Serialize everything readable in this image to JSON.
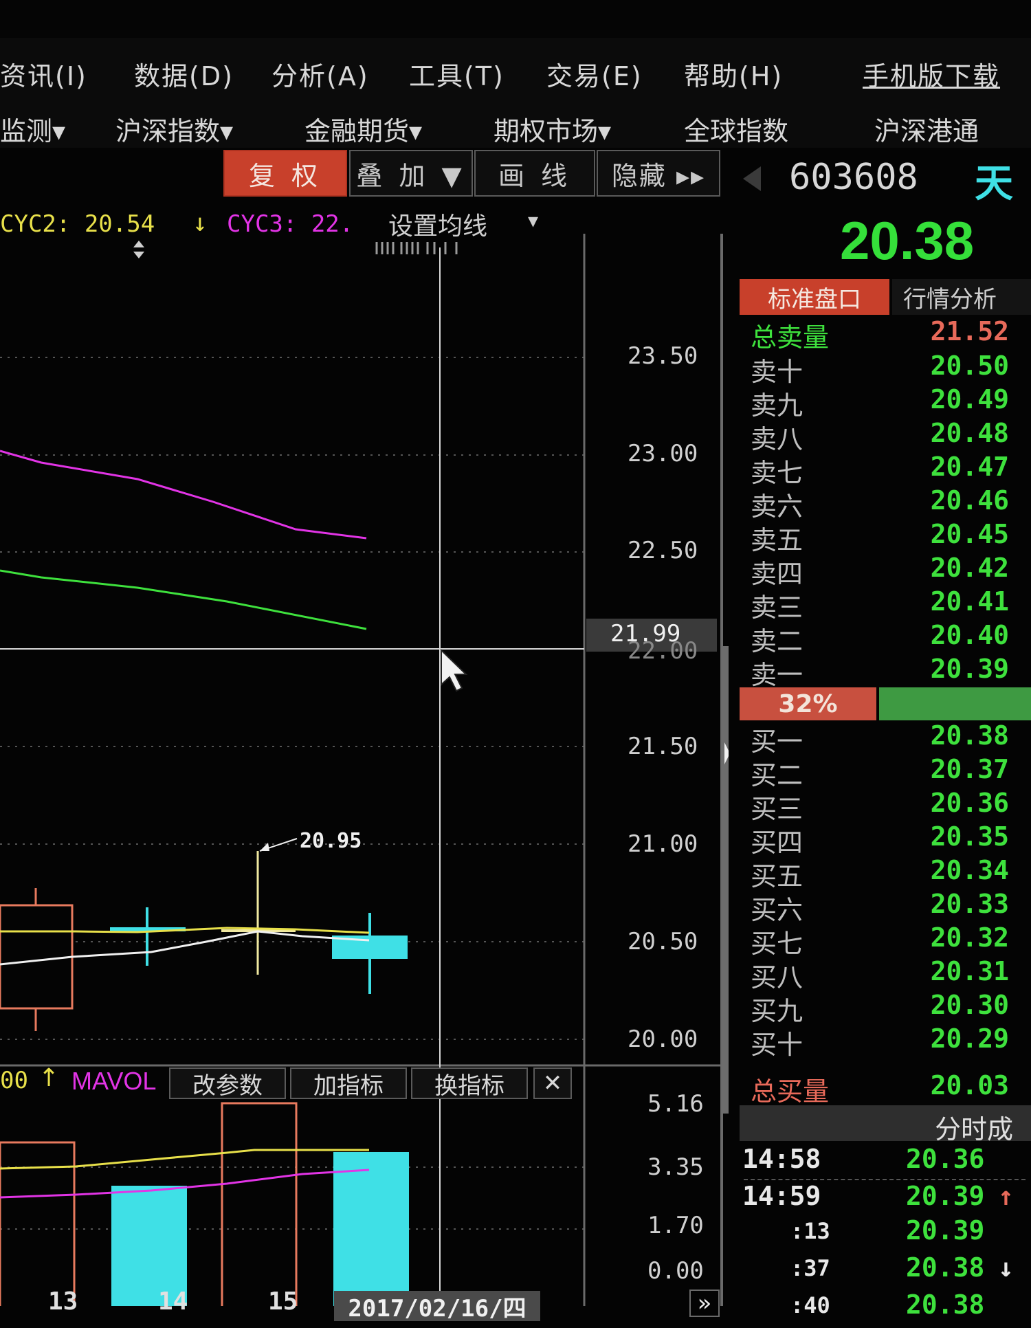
{
  "menu": [
    {
      "label": "资讯(I)"
    },
    {
      "label": "数据(D)"
    },
    {
      "label": "分析(A)"
    },
    {
      "label": "工具(T)"
    },
    {
      "label": "交易(E)"
    },
    {
      "label": "帮助(H)"
    }
  ],
  "mobile_download": "手机版下载",
  "submenu": [
    "监测▾",
    "沪深指数▾",
    "金融期货▾",
    "期权市场▾",
    "全球指数",
    "沪深港通"
  ],
  "toolbar": {
    "fuquan": "复 权",
    "diejia": "叠 加 ▼",
    "huaxian": "画 线",
    "yincang": "隐藏 ▸▸"
  },
  "stock": {
    "code": "603608",
    "name_partial": "天",
    "price": "20.38"
  },
  "indicators": {
    "cyc2": "CYC2: 20.54",
    "cyc2_arrow": "↓",
    "cyc3": "CYC3: 22.",
    "set_ma": "设置均线",
    "set_ma_arrow": "▾"
  },
  "price_axis": [
    "23.50",
    "23.00",
    "22.50",
    "22.00",
    "21.50",
    "21.00",
    "20.50",
    "20.00"
  ],
  "crosshair_price": "21.99",
  "high_annotation": "20.95",
  "volume_bar": {
    "prefix": "00",
    "arrow": "↑",
    "mavol": "MAVOL",
    "btn_params": "改参数",
    "btn_add": "加指标",
    "btn_switch": "换指标",
    "btn_close": "✕"
  },
  "volume_axis": [
    "5.16",
    "3.35",
    "1.70",
    "0.00"
  ],
  "date_axis": [
    "13",
    "14",
    "15"
  ],
  "date_highlight": "2017/02/16/四",
  "date_nav": "»",
  "order_book": {
    "tab_active": "标准盘口",
    "tab_other": "行情分析",
    "total_sell_label": "总卖量",
    "total_sell": "21.52",
    "sell": [
      {
        "label": "卖十",
        "price": "20.50"
      },
      {
        "label": "卖九",
        "price": "20.49"
      },
      {
        "label": "卖八",
        "price": "20.48"
      },
      {
        "label": "卖七",
        "price": "20.47"
      },
      {
        "label": "卖六",
        "price": "20.46"
      },
      {
        "label": "卖五",
        "price": "20.45"
      },
      {
        "label": "卖四",
        "price": "20.42"
      },
      {
        "label": "卖三",
        "price": "20.41"
      },
      {
        "label": "卖二",
        "price": "20.40"
      },
      {
        "label": "卖一",
        "price": "20.39"
      }
    ],
    "ratio": "32%",
    "ratio_value": 0.32,
    "buy": [
      {
        "label": "买一",
        "price": "20.38"
      },
      {
        "label": "买二",
        "price": "20.37"
      },
      {
        "label": "买三",
        "price": "20.36"
      },
      {
        "label": "买四",
        "price": "20.35"
      },
      {
        "label": "买五",
        "price": "20.34"
      },
      {
        "label": "买六",
        "price": "20.33"
      },
      {
        "label": "买七",
        "price": "20.32"
      },
      {
        "label": "买八",
        "price": "20.31"
      },
      {
        "label": "买九",
        "price": "20.30"
      },
      {
        "label": "买十",
        "price": "20.29"
      }
    ],
    "total_buy_label": "总买量",
    "total_buy": "20.03"
  },
  "ticks": {
    "header": "分时成",
    "rows": [
      {
        "time": "14:58",
        "price": "20.36",
        "arrow": ""
      },
      {
        "time": "14:59",
        "price": "20.39",
        "arrow": "↑"
      },
      {
        "time": ":13",
        "price": "20.39",
        "arrow": ""
      },
      {
        "time": ":37",
        "price": "20.38",
        "arrow": "↓"
      },
      {
        "time": ":40",
        "price": "20.38",
        "arrow": ""
      }
    ]
  },
  "colors": {
    "up": "#e77a5e",
    "down": "#3fe0e6",
    "green": "#3ee13d",
    "magenta": "#e234e6",
    "yellow": "#e8e04a",
    "accent_red": "#c8402b"
  }
}
